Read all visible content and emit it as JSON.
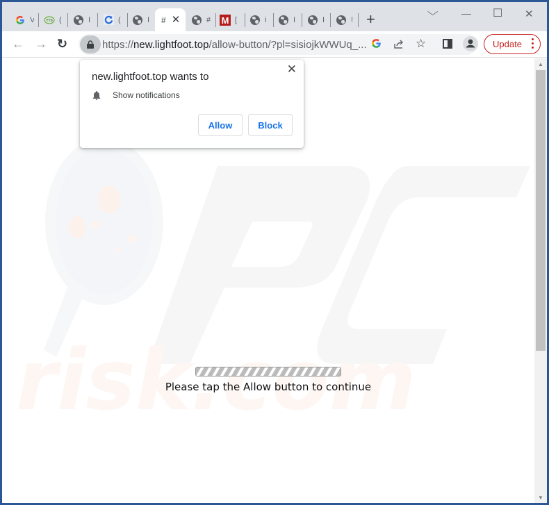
{
  "browser": {
    "tabs": [
      {
        "favicon": "google-icon",
        "title": "V",
        "active": false
      },
      {
        "favicon": "yts-icon",
        "title": "(",
        "active": false
      },
      {
        "favicon": "globe-icon",
        "title": "I",
        "active": false
      },
      {
        "favicon": "refresh-site-icon",
        "title": "(",
        "active": false
      },
      {
        "favicon": "globe-icon",
        "title": "I",
        "active": false
      },
      {
        "favicon": "",
        "title": "#",
        "active": true
      },
      {
        "favicon": "globe-icon",
        "title": "#",
        "active": false
      },
      {
        "favicon": "m-icon",
        "title": "[",
        "active": false
      },
      {
        "favicon": "globe-icon",
        "title": "i",
        "active": false
      },
      {
        "favicon": "globe-icon",
        "title": "I",
        "active": false
      },
      {
        "favicon": "globe-icon",
        "title": "I",
        "active": false
      },
      {
        "favicon": "globe-icon",
        "title": "!",
        "active": false
      }
    ],
    "new_tab_label": "+",
    "window_controls": {
      "tab_search": "⌵",
      "minimize": "—",
      "maximize": "☐",
      "close": "✕"
    },
    "nav": {
      "back": "←",
      "forward": "→",
      "reload": "↻"
    },
    "address": {
      "scheme": "https://",
      "host": "new.lightfoot.top",
      "path": "/allow-button/?pl=sisiojkWWUq_..."
    },
    "update_label": "Update",
    "accent_red": "#c5221f"
  },
  "permission_popup": {
    "title": "new.lightfoot.top wants to",
    "permission": "Show notifications",
    "allow_label": "Allow",
    "block_label": "Block",
    "close_label": "✕"
  },
  "page": {
    "watermark_text": "PC risk.com",
    "message": "Please tap the Allow button to continue",
    "progress_state": "indeterminate"
  }
}
